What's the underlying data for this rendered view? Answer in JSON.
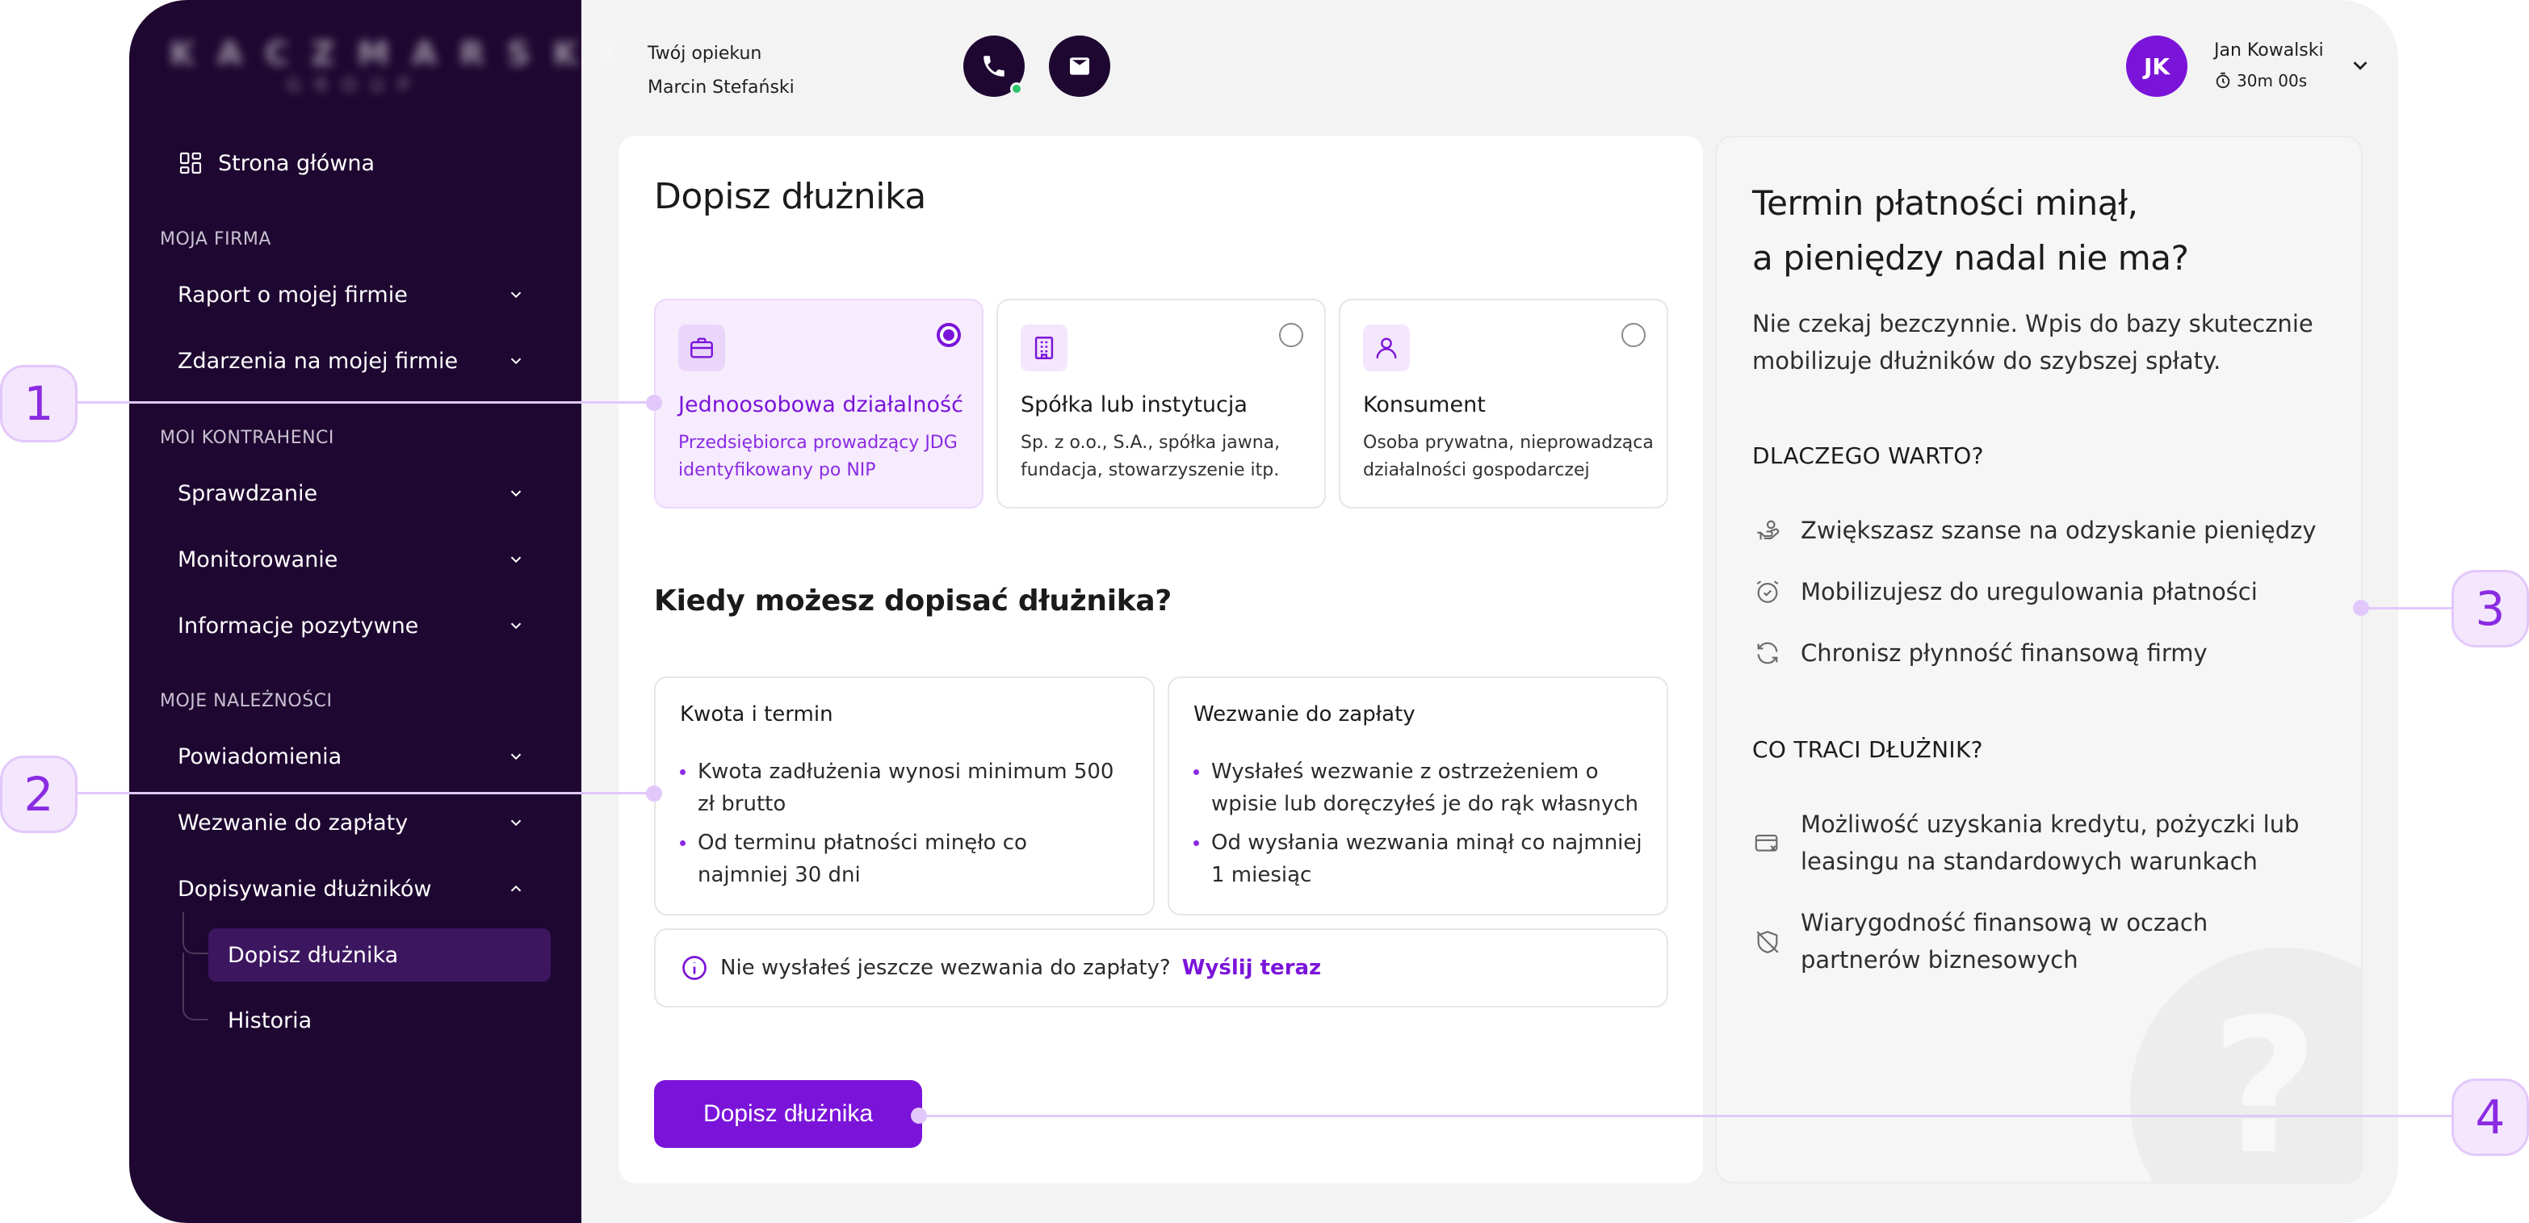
{
  "sidebar": {
    "logo_main": "KACZMARSKI",
    "logo_sub": "GROUP",
    "home": "Strona główna",
    "sections": {
      "firma": "MOJA FIRMA",
      "kontrahenci": "MOI KONTRAHENCI",
      "naleznosci": "MOJE NALEŻNOŚCI"
    },
    "items": {
      "raport": "Raport o mojej firmie",
      "zdarzenia": "Zdarzenia na mojej firmie",
      "sprawdzanie": "Sprawdzanie",
      "monitorowanie": "Monitorowanie",
      "informacje": "Informacje pozytywne",
      "powiadomienia": "Powiadomienia",
      "wezwanie": "Wezwanie do zapłaty",
      "dopisywanie": "Dopisywanie dłużników",
      "dopisz": "Dopisz dłużnika",
      "historia": "Historia"
    }
  },
  "topbar": {
    "guardian_label": "Twój opiekun",
    "guardian_name": "Marcin Stefański",
    "avatar_initials": "JK",
    "user_name": "Jan Kowalski",
    "session_timer": "30m 00s"
  },
  "form": {
    "title": "Dopisz dłużnika",
    "options": [
      {
        "title": "Jednoosobowa działalność",
        "desc": "Przedsiębiorca prowadzący JDG identyfikowany po NIP",
        "selected": true
      },
      {
        "title": "Spółka lub instytucja",
        "desc": "Sp. z o.o., S.A., spółka jawna, fundacja, stowarzyszenie itp.",
        "selected": false
      },
      {
        "title": "Konsument",
        "desc": "Osoba prywatna, nieprowadząca działalności gospodarczej",
        "selected": false
      }
    ],
    "when_title": "Kiedy możesz dopisać dłużnika?",
    "rules": [
      {
        "title": "Kwota i termin",
        "items": [
          "Kwota zadłużenia wynosi minimum 500 zł brutto",
          "Od terminu płatności minęło co najmniej 30 dni"
        ]
      },
      {
        "title": "Wezwanie do zapłaty",
        "items": [
          "Wysłałeś wezwanie z ostrzeżeniem o wpisie lub doręczyłeś je do rąk własnych",
          "Od wysłania wezwania minął co najmniej 1 miesiąc"
        ]
      }
    ],
    "info_text": "Nie wysłałeś jeszcze wezwania do zapłaty?",
    "info_link": "Wyślij teraz",
    "submit": "Dopisz dłużnika"
  },
  "info_card": {
    "title_line1": "Termin płatności minął,",
    "title_line2": "a pieniędzy nadal nie ma?",
    "text": "Nie czekaj bezczynnie. Wpis do bazy skutecznie mobilizuje dłużników do szybszej spłaty.",
    "why_title": "DLACZEGO WARTO?",
    "why_items": [
      {
        "icon": "hand-coins-icon",
        "text": "Zwiększasz szanse na odzyskanie pieniędzy"
      },
      {
        "icon": "alarm-clock-icon",
        "text": "Mobilizujesz do uregulowania płatności"
      },
      {
        "icon": "refresh-icon",
        "text": "Chronisz płynność finansową firmy"
      }
    ],
    "lose_title": "CO TRACI DŁUŻNIK?",
    "lose_items": [
      {
        "icon": "card-x-icon",
        "text": "Możliwość uzyskania kredytu, pożyczki lub leasingu na standardowych warunkach"
      },
      {
        "icon": "shield-off-icon",
        "text": "Wiarygodność finansową w oczach partnerów biznesowych"
      }
    ],
    "bg_glyph": "?"
  },
  "callouts": [
    "1",
    "2",
    "3",
    "4"
  ],
  "colors": {
    "accent": "#7b14d9",
    "sidebar": "#1e0730",
    "callout": "#f3e6fd"
  }
}
